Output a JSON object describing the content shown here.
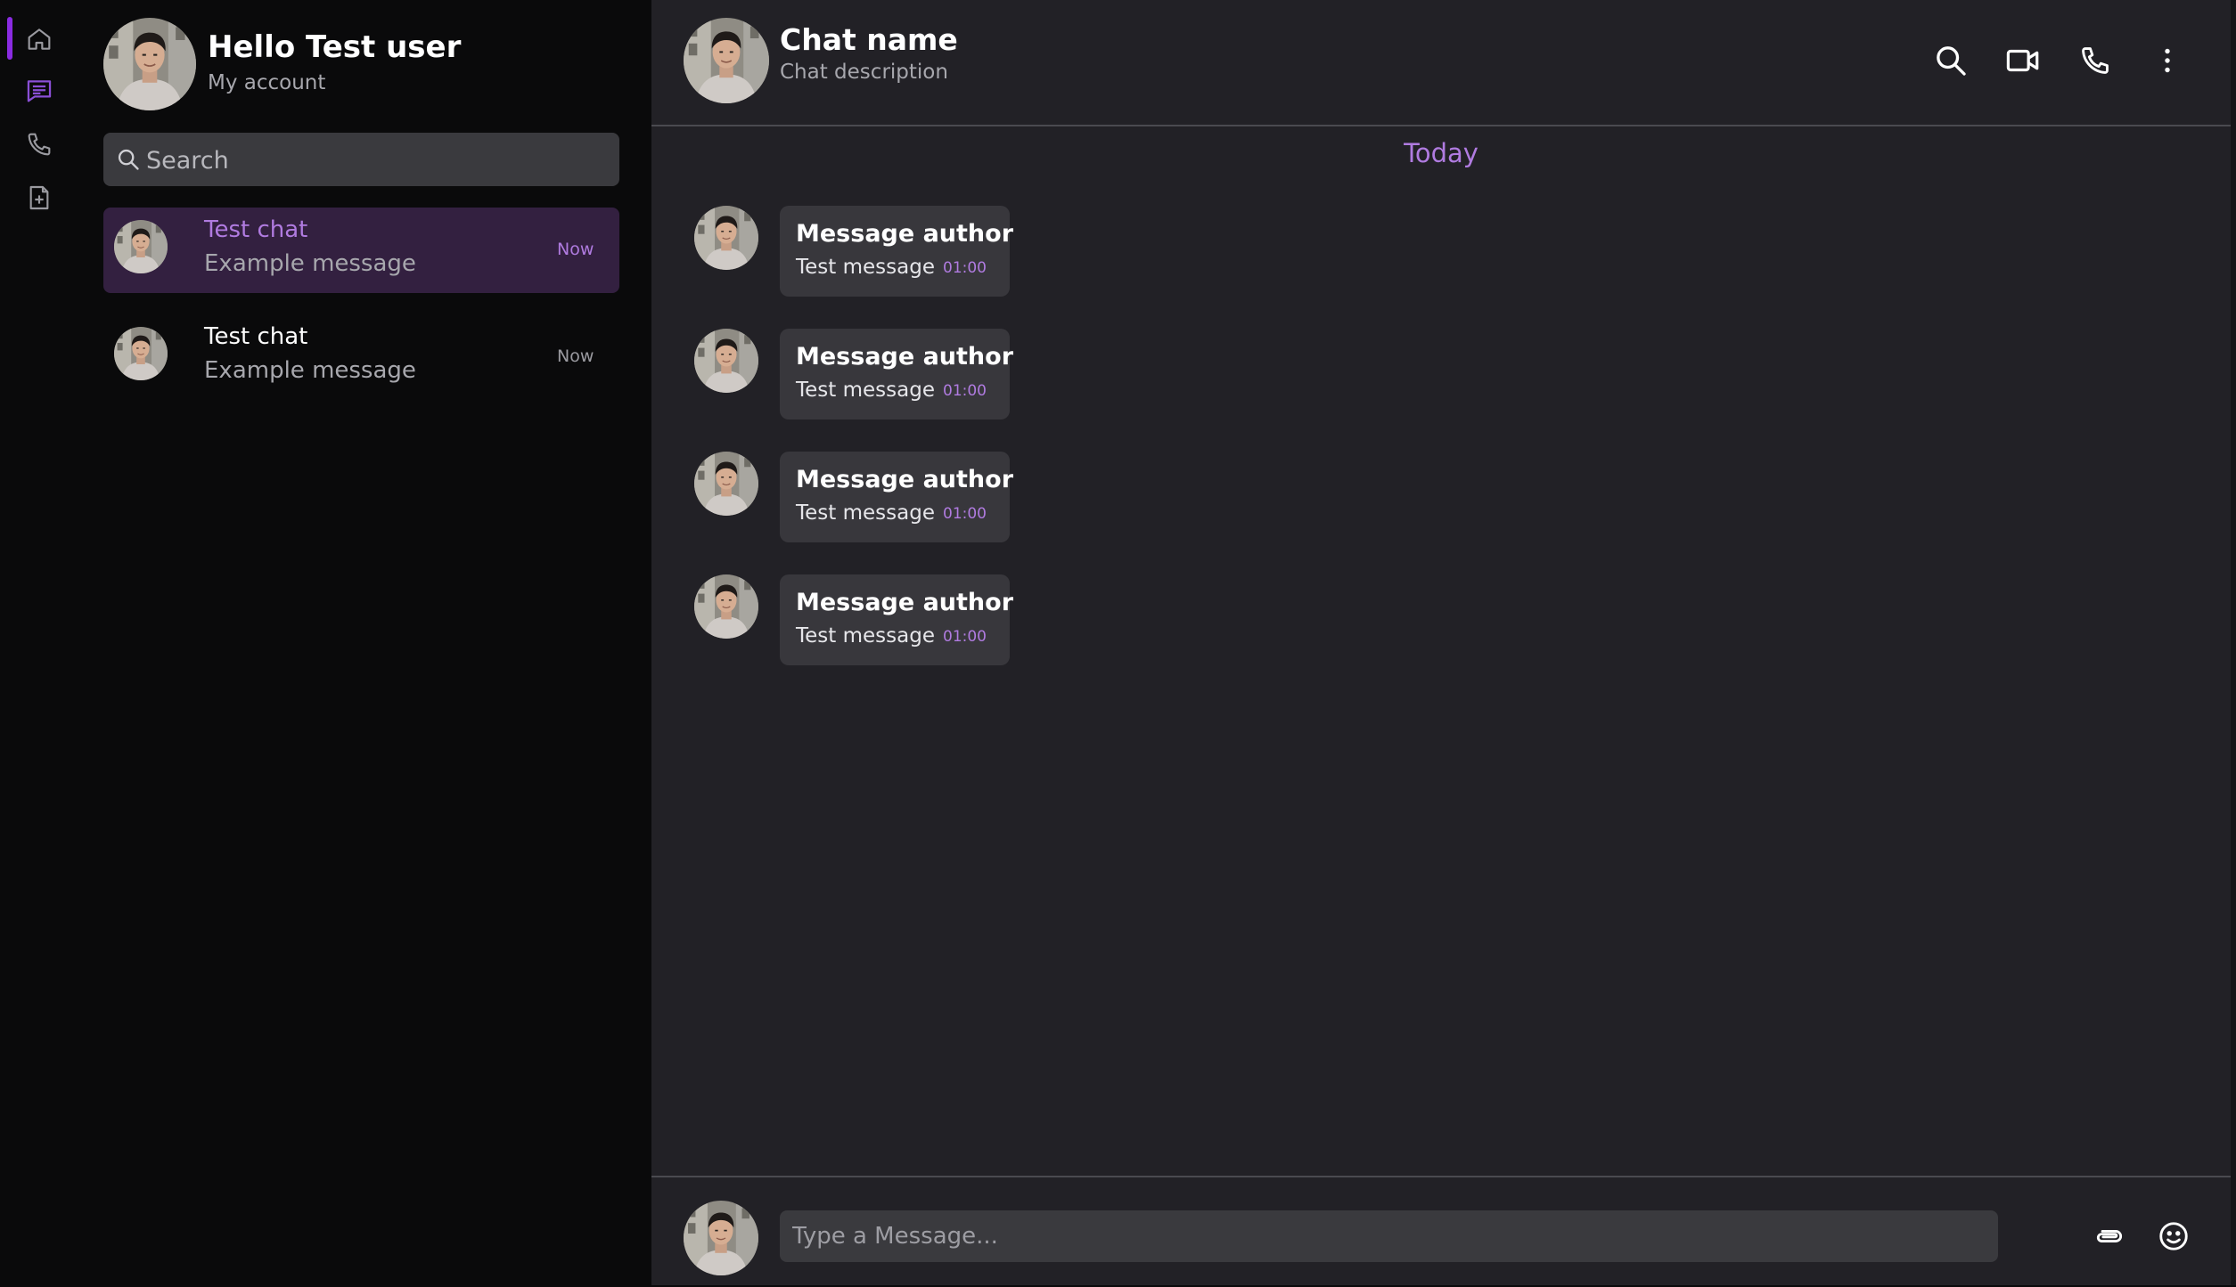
{
  "colors": {
    "accent": "#b07be0",
    "accent_strong": "#8a2be2",
    "active_chat_bg": "#332040",
    "main_bg": "#222126",
    "sidebar_bg": "#0a0a0b",
    "bubble_bg": "#38373c"
  },
  "nav_rail": {
    "items": [
      {
        "icon": "home-icon",
        "active": true
      },
      {
        "icon": "chat-icon",
        "active": false
      },
      {
        "icon": "phone-icon",
        "active": false
      },
      {
        "icon": "file-add-icon",
        "active": false
      }
    ]
  },
  "account": {
    "greeting": "Hello Test user",
    "subtitle": "My account",
    "avatar": "user-avatar"
  },
  "search": {
    "placeholder": "Search",
    "icon": "search-icon"
  },
  "chat_list": [
    {
      "title": "Test chat",
      "message": "Example message",
      "time": "Now",
      "active": true
    },
    {
      "title": "Test chat",
      "message": "Example message",
      "time": "Now",
      "active": false
    }
  ],
  "header": {
    "title": "Chat name",
    "description": "Chat description",
    "actions": [
      "search-icon",
      "video-call-icon",
      "phone-icon",
      "more-vertical-icon"
    ]
  },
  "conversation": {
    "day_label": "Today",
    "messages": [
      {
        "author": "Message author",
        "text": "Test message",
        "time": "01:00"
      },
      {
        "author": "Message author",
        "text": "Test message",
        "time": "01:00"
      },
      {
        "author": "Message author",
        "text": "Test message",
        "time": "01:00"
      },
      {
        "author": "Message author",
        "text": "Test message",
        "time": "01:00"
      }
    ]
  },
  "composer": {
    "placeholder": "Type a Message...",
    "actions": [
      "attach-icon",
      "emoji-icon"
    ]
  }
}
